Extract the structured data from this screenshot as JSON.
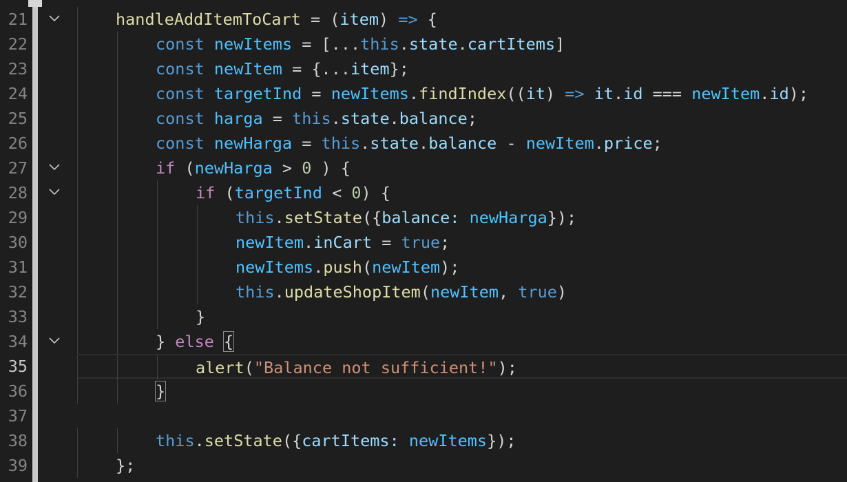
{
  "editor": {
    "colors": {
      "background": "#1e1e1e",
      "keyword": "#569cd6",
      "control": "#c586c0",
      "function": "#dcdcaa",
      "variable": "#9cdcfe",
      "constant": "#4fc1ff",
      "number": "#b5cea8",
      "string": "#ce9178",
      "punctuation": "#d4d4d4"
    },
    "current_line": 35,
    "lines": [
      {
        "no": "21",
        "fold": true,
        "indent": 1,
        "tokens": [
          {
            "t": "handleAddItemToCart",
            "c": "fn"
          },
          {
            "t": " = (",
            "c": "punc"
          },
          {
            "t": "item",
            "c": "var"
          },
          {
            "t": ") ",
            "c": "punc"
          },
          {
            "t": "=>",
            "c": "kw"
          },
          {
            "t": " {",
            "c": "punc"
          }
        ]
      },
      {
        "no": "22",
        "fold": false,
        "indent": 2,
        "tokens": [
          {
            "t": "const",
            "c": "kw"
          },
          {
            "t": " ",
            "c": "punc"
          },
          {
            "t": "newItems",
            "c": "const"
          },
          {
            "t": " = [...",
            "c": "punc"
          },
          {
            "t": "this",
            "c": "kw"
          },
          {
            "t": ".",
            "c": "punc"
          },
          {
            "t": "state",
            "c": "var"
          },
          {
            "t": ".",
            "c": "punc"
          },
          {
            "t": "cartItems",
            "c": "var"
          },
          {
            "t": "]",
            "c": "punc"
          }
        ]
      },
      {
        "no": "23",
        "fold": false,
        "indent": 2,
        "tokens": [
          {
            "t": "const",
            "c": "kw"
          },
          {
            "t": " ",
            "c": "punc"
          },
          {
            "t": "newItem",
            "c": "const"
          },
          {
            "t": " = {...",
            "c": "punc"
          },
          {
            "t": "item",
            "c": "var"
          },
          {
            "t": "};",
            "c": "punc"
          }
        ]
      },
      {
        "no": "24",
        "fold": false,
        "indent": 2,
        "tokens": [
          {
            "t": "const",
            "c": "kw"
          },
          {
            "t": " ",
            "c": "punc"
          },
          {
            "t": "targetInd",
            "c": "const"
          },
          {
            "t": " = ",
            "c": "punc"
          },
          {
            "t": "newItems",
            "c": "const"
          },
          {
            "t": ".",
            "c": "punc"
          },
          {
            "t": "findIndex",
            "c": "fn"
          },
          {
            "t": "((",
            "c": "punc"
          },
          {
            "t": "it",
            "c": "var"
          },
          {
            "t": ") ",
            "c": "punc"
          },
          {
            "t": "=>",
            "c": "kw"
          },
          {
            "t": " ",
            "c": "punc"
          },
          {
            "t": "it",
            "c": "var"
          },
          {
            "t": ".",
            "c": "punc"
          },
          {
            "t": "id",
            "c": "var"
          },
          {
            "t": " === ",
            "c": "punc"
          },
          {
            "t": "newItem",
            "c": "const"
          },
          {
            "t": ".",
            "c": "punc"
          },
          {
            "t": "id",
            "c": "var"
          },
          {
            "t": ");",
            "c": "punc"
          }
        ]
      },
      {
        "no": "25",
        "fold": false,
        "indent": 2,
        "tokens": [
          {
            "t": "const",
            "c": "kw"
          },
          {
            "t": " ",
            "c": "punc"
          },
          {
            "t": "harga",
            "c": "const"
          },
          {
            "t": " = ",
            "c": "punc"
          },
          {
            "t": "this",
            "c": "kw"
          },
          {
            "t": ".",
            "c": "punc"
          },
          {
            "t": "state",
            "c": "var"
          },
          {
            "t": ".",
            "c": "punc"
          },
          {
            "t": "balance",
            "c": "var"
          },
          {
            "t": ";",
            "c": "punc"
          }
        ]
      },
      {
        "no": "26",
        "fold": false,
        "indent": 2,
        "tokens": [
          {
            "t": "const",
            "c": "kw"
          },
          {
            "t": " ",
            "c": "punc"
          },
          {
            "t": "newHarga",
            "c": "const"
          },
          {
            "t": " = ",
            "c": "punc"
          },
          {
            "t": "this",
            "c": "kw"
          },
          {
            "t": ".",
            "c": "punc"
          },
          {
            "t": "state",
            "c": "var"
          },
          {
            "t": ".",
            "c": "punc"
          },
          {
            "t": "balance",
            "c": "var"
          },
          {
            "t": " - ",
            "c": "punc"
          },
          {
            "t": "newItem",
            "c": "const"
          },
          {
            "t": ".",
            "c": "punc"
          },
          {
            "t": "price",
            "c": "var"
          },
          {
            "t": ";",
            "c": "punc"
          }
        ]
      },
      {
        "no": "27",
        "fold": true,
        "indent": 2,
        "tokens": [
          {
            "t": "if",
            "c": "ctrl"
          },
          {
            "t": " (",
            "c": "punc"
          },
          {
            "t": "newHarga",
            "c": "const"
          },
          {
            "t": " > ",
            "c": "punc"
          },
          {
            "t": "0",
            "c": "num"
          },
          {
            "t": " ) {",
            "c": "punc"
          }
        ]
      },
      {
        "no": "28",
        "fold": true,
        "indent": 3,
        "tokens": [
          {
            "t": "if",
            "c": "ctrl"
          },
          {
            "t": " (",
            "c": "punc"
          },
          {
            "t": "targetInd",
            "c": "const"
          },
          {
            "t": " < ",
            "c": "punc"
          },
          {
            "t": "0",
            "c": "num"
          },
          {
            "t": ") {",
            "c": "punc"
          }
        ]
      },
      {
        "no": "29",
        "fold": false,
        "indent": 4,
        "tokens": [
          {
            "t": "this",
            "c": "kw"
          },
          {
            "t": ".",
            "c": "punc"
          },
          {
            "t": "setState",
            "c": "fn"
          },
          {
            "t": "({",
            "c": "punc"
          },
          {
            "t": "balance",
            "c": "var"
          },
          {
            "t": ": ",
            "c": "var"
          },
          {
            "t": "newHarga",
            "c": "const"
          },
          {
            "t": "});",
            "c": "punc"
          }
        ]
      },
      {
        "no": "30",
        "fold": false,
        "indent": 4,
        "tokens": [
          {
            "t": "newItem",
            "c": "const"
          },
          {
            "t": ".",
            "c": "punc"
          },
          {
            "t": "inCart",
            "c": "var"
          },
          {
            "t": " = ",
            "c": "punc"
          },
          {
            "t": "true",
            "c": "kw"
          },
          {
            "t": ";",
            "c": "punc"
          }
        ]
      },
      {
        "no": "31",
        "fold": false,
        "indent": 4,
        "tokens": [
          {
            "t": "newItems",
            "c": "const"
          },
          {
            "t": ".",
            "c": "punc"
          },
          {
            "t": "push",
            "c": "fn"
          },
          {
            "t": "(",
            "c": "punc"
          },
          {
            "t": "newItem",
            "c": "const"
          },
          {
            "t": ");",
            "c": "punc"
          }
        ]
      },
      {
        "no": "32",
        "fold": false,
        "indent": 4,
        "tokens": [
          {
            "t": "this",
            "c": "kw"
          },
          {
            "t": ".",
            "c": "punc"
          },
          {
            "t": "updateShopItem",
            "c": "fn"
          },
          {
            "t": "(",
            "c": "punc"
          },
          {
            "t": "newItem",
            "c": "const"
          },
          {
            "t": ", ",
            "c": "punc"
          },
          {
            "t": "true",
            "c": "kw"
          },
          {
            "t": ")",
            "c": "punc"
          }
        ]
      },
      {
        "no": "33",
        "fold": false,
        "indent": 3,
        "tokens": [
          {
            "t": "}",
            "c": "punc"
          }
        ]
      },
      {
        "no": "34",
        "fold": true,
        "indent": 2,
        "tokens": [
          {
            "t": "} ",
            "c": "punc"
          },
          {
            "t": "else",
            "c": "ctrl"
          },
          {
            "t": " ",
            "c": "punc"
          },
          {
            "t": "{",
            "c": "punc",
            "box": true
          }
        ]
      },
      {
        "no": "35",
        "fold": false,
        "indent": 3,
        "tokens": [
          {
            "t": "alert",
            "c": "fn"
          },
          {
            "t": "(",
            "c": "punc"
          },
          {
            "t": "\"Balance not sufficient!\"",
            "c": "str"
          },
          {
            "t": ");",
            "c": "punc"
          }
        ]
      },
      {
        "no": "36",
        "fold": false,
        "indent": 2,
        "tokens": [
          {
            "t": "}",
            "c": "punc",
            "box": true
          }
        ]
      },
      {
        "no": "37",
        "fold": false,
        "indent": 0,
        "tokens": []
      },
      {
        "no": "38",
        "fold": false,
        "indent": 2,
        "tokens": [
          {
            "t": "this",
            "c": "kw"
          },
          {
            "t": ".",
            "c": "punc"
          },
          {
            "t": "setState",
            "c": "fn"
          },
          {
            "t": "({",
            "c": "punc"
          },
          {
            "t": "cartItems",
            "c": "var"
          },
          {
            "t": ": ",
            "c": "var"
          },
          {
            "t": "newItems",
            "c": "const"
          },
          {
            "t": "});",
            "c": "punc"
          }
        ]
      },
      {
        "no": "39",
        "fold": false,
        "indent": 1,
        "tokens": [
          {
            "t": "};",
            "c": "punc"
          }
        ]
      }
    ]
  }
}
